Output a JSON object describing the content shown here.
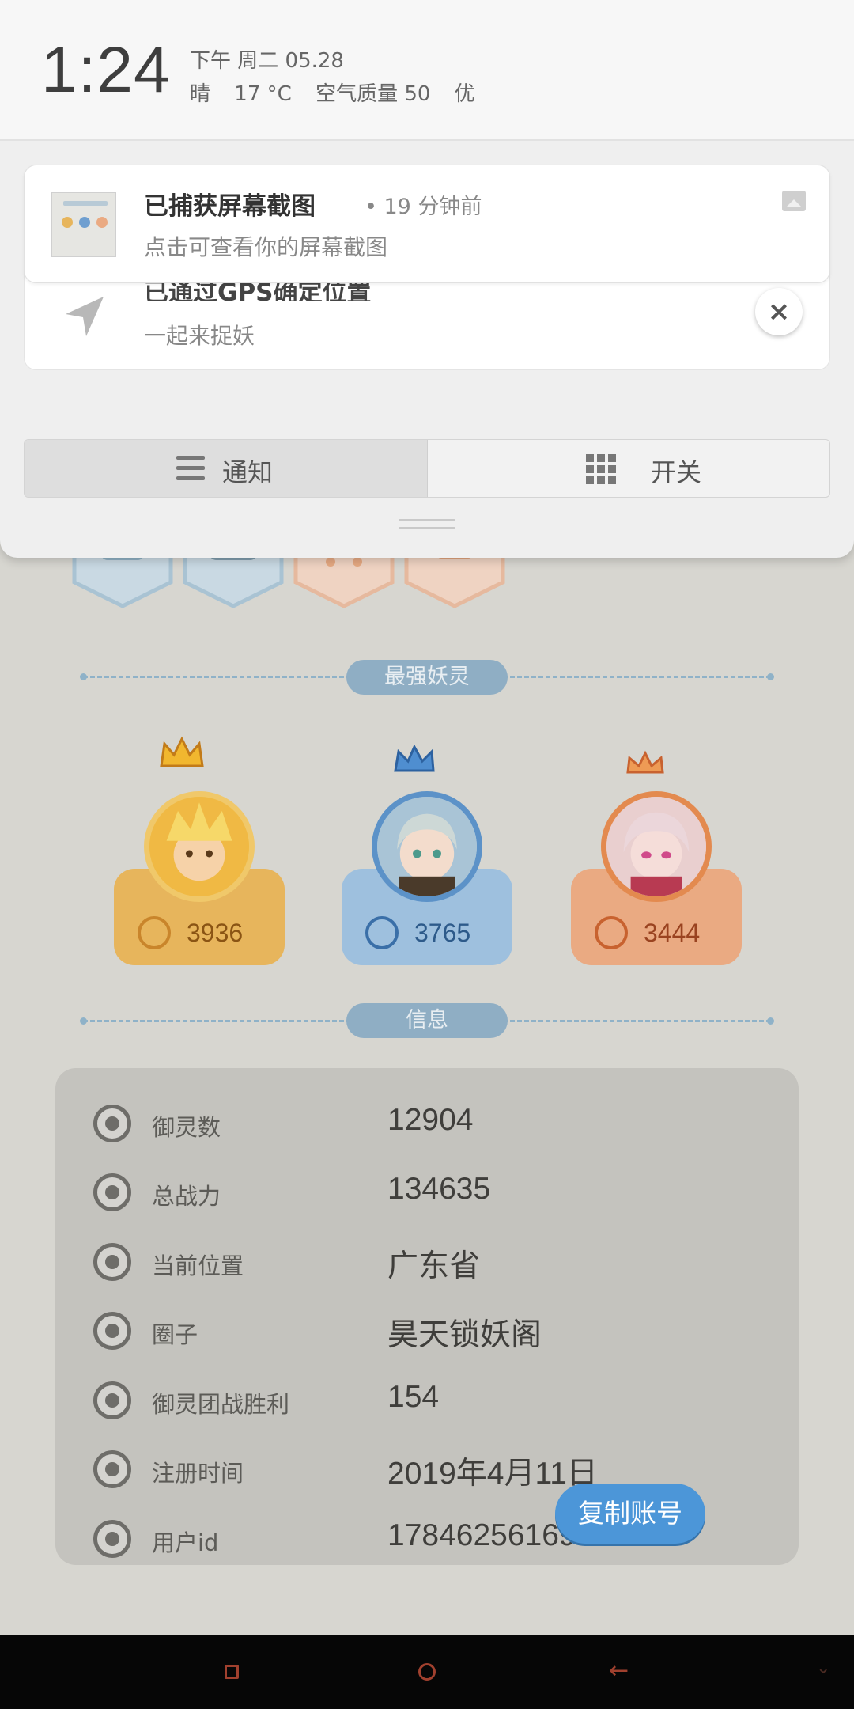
{
  "status": {
    "time": "1:24",
    "date_line": "下午 周二  05.28",
    "weather": "晴",
    "temperature": "17 °C",
    "air_quality": "空气质量 50",
    "air_level": "优"
  },
  "notifications": {
    "screenshot": {
      "title": "已捕获屏幕截图",
      "time": "• 19 分钟前",
      "body": "点击可查看你的屏幕截图"
    },
    "gps": {
      "title": "已通过GPS确定位置",
      "body": "一起来捉妖"
    },
    "close_label": "×"
  },
  "tabs": {
    "notify": "通知",
    "switch": "开关"
  },
  "game": {
    "section_strongest": "最强妖灵",
    "section_info": "信息",
    "top_spirits": [
      {
        "power": "3936",
        "color": "#e7b55c",
        "accent": "#c9852b"
      },
      {
        "power": "3765",
        "color": "#9ec0de",
        "accent": "#3a6fa8"
      },
      {
        "power": "3444",
        "color": "#eaaa82",
        "accent": "#c8622f"
      }
    ],
    "info": {
      "spirits_label": "御灵数",
      "spirits_value": "12904",
      "power_label": "总战力",
      "power_value": "134635",
      "location_label": "当前位置",
      "location_value": "广东省",
      "circle_label": "圈子",
      "circle_value": "昊天锁妖阁",
      "wins_label": "御灵团战胜利",
      "wins_value": "154",
      "reg_label": "注册时间",
      "reg_value": "2019年4月11日",
      "uid_label": "用户id",
      "uid_value": "17846256169"
    },
    "copy_button": "复制账号"
  },
  "navbar": {
    "back_glyph": "←",
    "down_glyph": "⌄"
  }
}
